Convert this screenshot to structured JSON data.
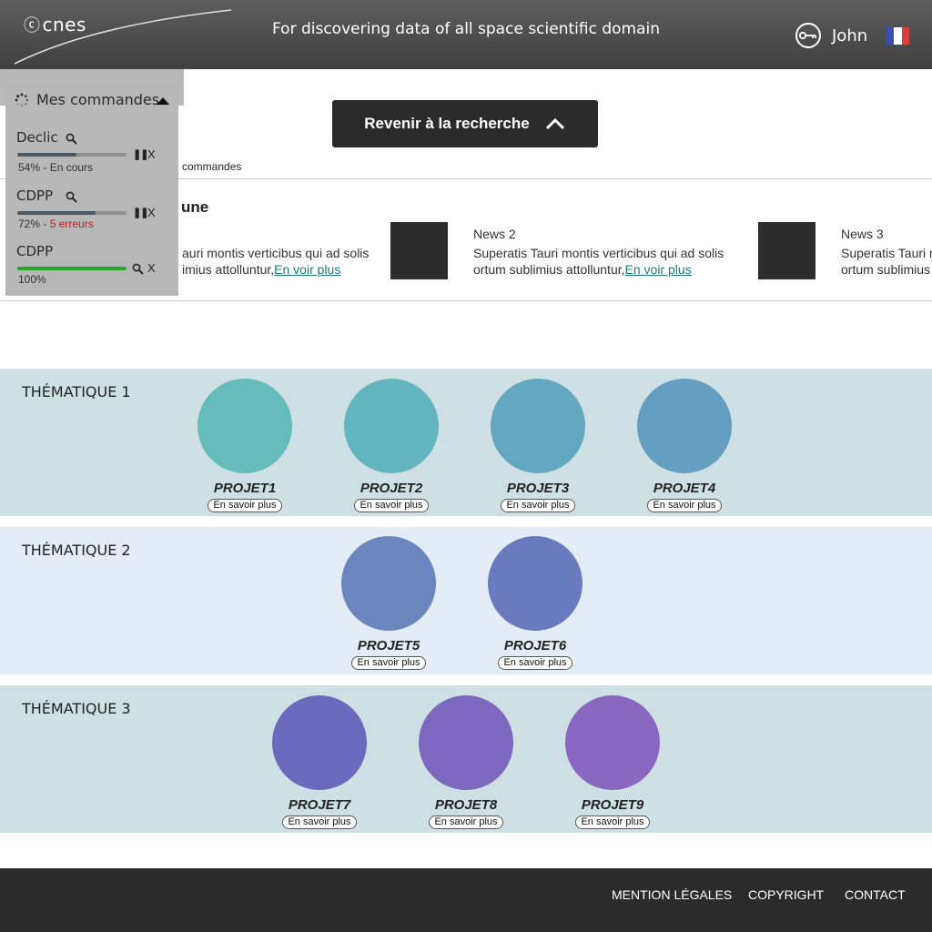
{
  "header": {
    "logo_text": "cnes",
    "tagline": "For discovering data of all space scientific domain",
    "username": "John",
    "colors": {
      "bar": "#4a4a4a"
    }
  },
  "back_button": {
    "label": "Revenir à la recherche"
  },
  "breadcrumb_fragment": "commandes",
  "news_section": {
    "title_fragment": "une",
    "items": [
      {
        "title": "",
        "line1": "auri montis verticibus qui ad solis",
        "line2": "imius attolluntur,",
        "more": "En voir plus "
      },
      {
        "title": "News 2",
        "line1": "Superatis Tauri montis verticibus qui ad solis",
        "line2": "ortum sublimius attolluntur,",
        "more": "En voir plus "
      },
      {
        "title": "News 3",
        "line1": "Superatis Tauri m",
        "line2": "ortum sublimius",
        "more": ""
      }
    ]
  },
  "orders": {
    "title": "Mes commandes",
    "items": [
      {
        "name": "Declic",
        "progress": 0.54,
        "status_pct": "54% - ",
        "status_text": "En cours",
        "has_error": false
      },
      {
        "name": "CDPP",
        "progress": 0.72,
        "status_pct": "72% - ",
        "status_text": "5 erreurs",
        "has_error": true
      },
      {
        "name": "CDPP",
        "progress": 1.0,
        "status_pct": "100%",
        "status_text": "",
        "has_error": false
      }
    ],
    "pause_glyph": "❚❚",
    "close_glyph": "X"
  },
  "thematiques": [
    {
      "label": "THÉMATIQUE 1",
      "bg": "#cfe0e5",
      "projects": [
        {
          "name": "PROJET1",
          "color": "#65bcbb",
          "cta": "En savoir plus"
        },
        {
          "name": "PROJET2",
          "color": "#63b5bf",
          "cta": "En savoir plus"
        },
        {
          "name": "PROJET3",
          "color": "#64a7c0",
          "cta": "En savoir plus"
        },
        {
          "name": "PROJET4",
          "color": "#649ec0",
          "cta": "En savoir plus"
        }
      ]
    },
    {
      "label": "THÉMATIQUE 2",
      "bg": "#e4edf5",
      "projects": [
        {
          "name": "PROJET5",
          "color": "#6b86bf",
          "cta": "En savoir plus"
        },
        {
          "name": "PROJET6",
          "color": "#6a7abf",
          "cta": "En savoir plus"
        }
      ]
    },
    {
      "label": "THÉMATIQUE 3",
      "bg": "#cfe0e5",
      "projects": [
        {
          "name": "PROJET7",
          "color": "#6b68bd",
          "cta": "En savoir plus"
        },
        {
          "name": "PROJET8",
          "color": "#7e67be",
          "cta": "En savoir plus"
        },
        {
          "name": "PROJET9",
          "color": "#8a67c0",
          "cta": "En savoir plus"
        }
      ]
    }
  ],
  "footer": {
    "links": [
      "MENTION LÉGALES",
      "COPYRIGHT",
      "CONTACT"
    ]
  }
}
